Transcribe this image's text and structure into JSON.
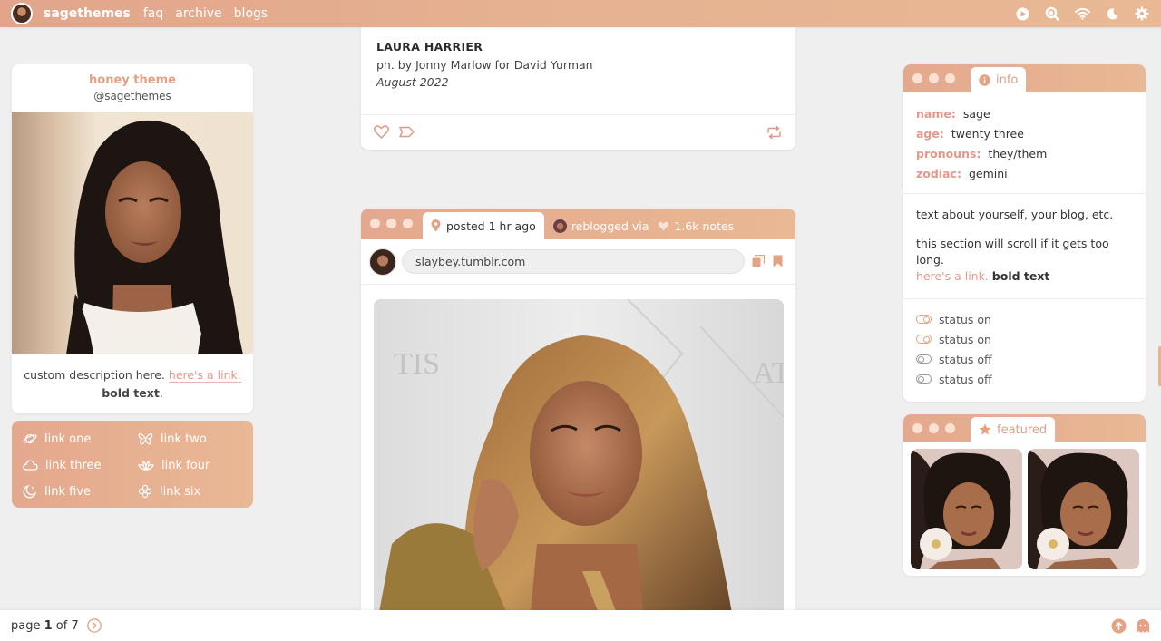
{
  "topbar": {
    "brand": "sagethemes",
    "nav": [
      "faq",
      "archive",
      "blogs"
    ],
    "icons": [
      "play-icon",
      "search-icon",
      "wifi-icon",
      "moon-icon",
      "gear-icon"
    ]
  },
  "profile": {
    "title": "honey theme",
    "handle": "@sagethemes",
    "desc_text": "custom description here.",
    "desc_link": "here's a link.",
    "desc_bold": "bold text",
    "desc_end": "."
  },
  "links": [
    {
      "label": "link one",
      "icon": "planet-icon"
    },
    {
      "label": "link two",
      "icon": "butterfly-icon"
    },
    {
      "label": "link three",
      "icon": "cloud-icon"
    },
    {
      "label": "link four",
      "icon": "lotus-icon"
    },
    {
      "label": "link five",
      "icon": "moon-stars-icon"
    },
    {
      "label": "link six",
      "icon": "flower-icon"
    }
  ],
  "post1": {
    "title": "LAURA HARRIER",
    "credit": "ph. by Jonny Marlow for David Yurman",
    "date": "August 2022"
  },
  "post2": {
    "tab": "posted 1 hr ago",
    "reblogged": "reblogged via",
    "notes": "1.6k notes",
    "url": "slaybey.tumblr.com"
  },
  "info": {
    "tab": "info",
    "rows": [
      {
        "key": "name:",
        "value": "sage"
      },
      {
        "key": "age:",
        "value": "twenty three"
      },
      {
        "key": "pronouns:",
        "value": "they/them"
      },
      {
        "key": "zodiac:",
        "value": "gemini"
      }
    ],
    "about1": "text about yourself, your blog, etc.",
    "about2": "this section will scroll if it gets too long.",
    "about_link": "here's a link.",
    "about_bold": "bold text",
    "statuses": [
      {
        "label": "status on",
        "on": true
      },
      {
        "label": "status on",
        "on": true
      },
      {
        "label": "status off",
        "on": false
      },
      {
        "label": "status off",
        "on": false
      }
    ]
  },
  "featured": {
    "tab": "featured"
  },
  "footer": {
    "page_prefix": "page ",
    "page_current": "1",
    "page_of": " of 7"
  },
  "colors": {
    "accent": "#e3a284",
    "link": "#e3998a",
    "bar_start": "#e2a58b",
    "bar_end": "#e9b894"
  }
}
